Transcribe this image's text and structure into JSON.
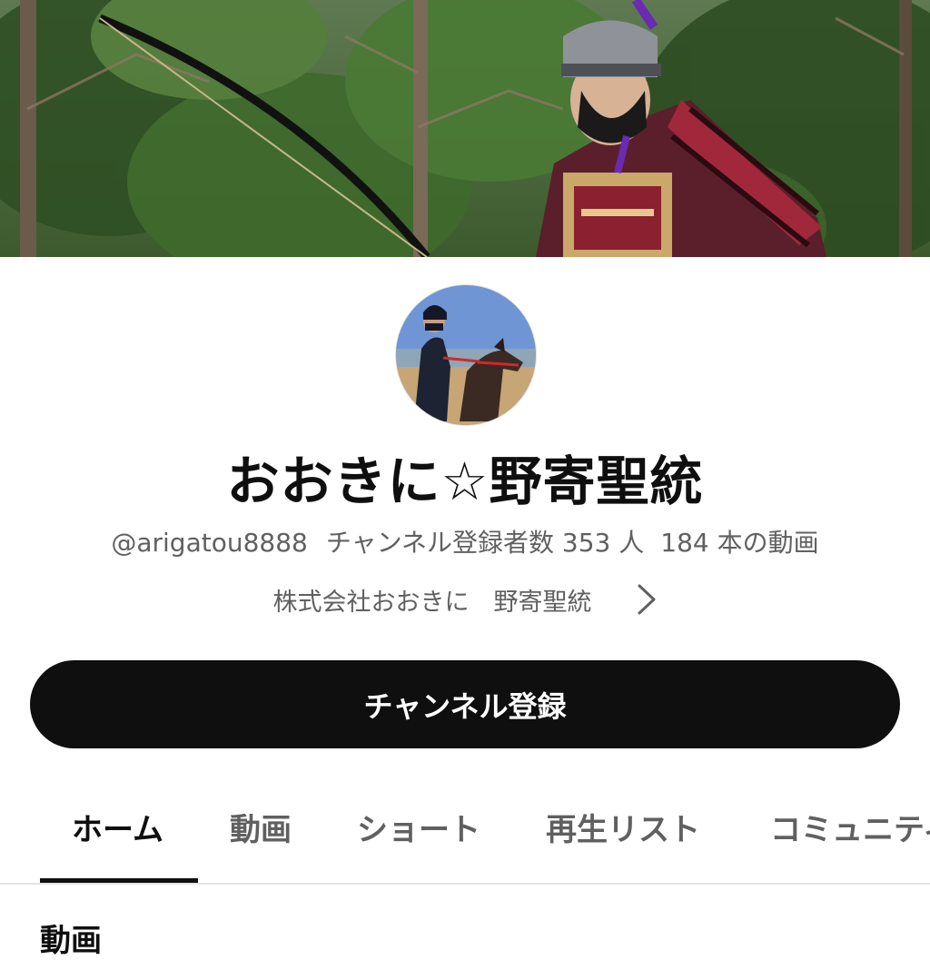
{
  "banner": {
    "icon": "banner-photo-samurai-archer"
  },
  "avatar": {
    "icon": "avatar-photo-horse-rider"
  },
  "channel": {
    "name": "おおきに☆野寄聖統",
    "handle": "@arigatou8888",
    "subscribers": "チャンネル登録者数 353 人",
    "video_count": "184 本の動画",
    "description": "株式会社おおきに　野寄聖統"
  },
  "subscribe": {
    "label": "チャンネル登録"
  },
  "tabs": [
    {
      "label": "ホーム",
      "active": true
    },
    {
      "label": "動画"
    },
    {
      "label": "ショート"
    },
    {
      "label": "再生リスト"
    },
    {
      "label": "コミュニティ"
    }
  ],
  "section": {
    "title": "動画"
  },
  "colors": {
    "primary_text": "#0f0f0f",
    "secondary_text": "#606060",
    "button_bg": "#0f0f0f",
    "button_text": "#ffffff"
  }
}
